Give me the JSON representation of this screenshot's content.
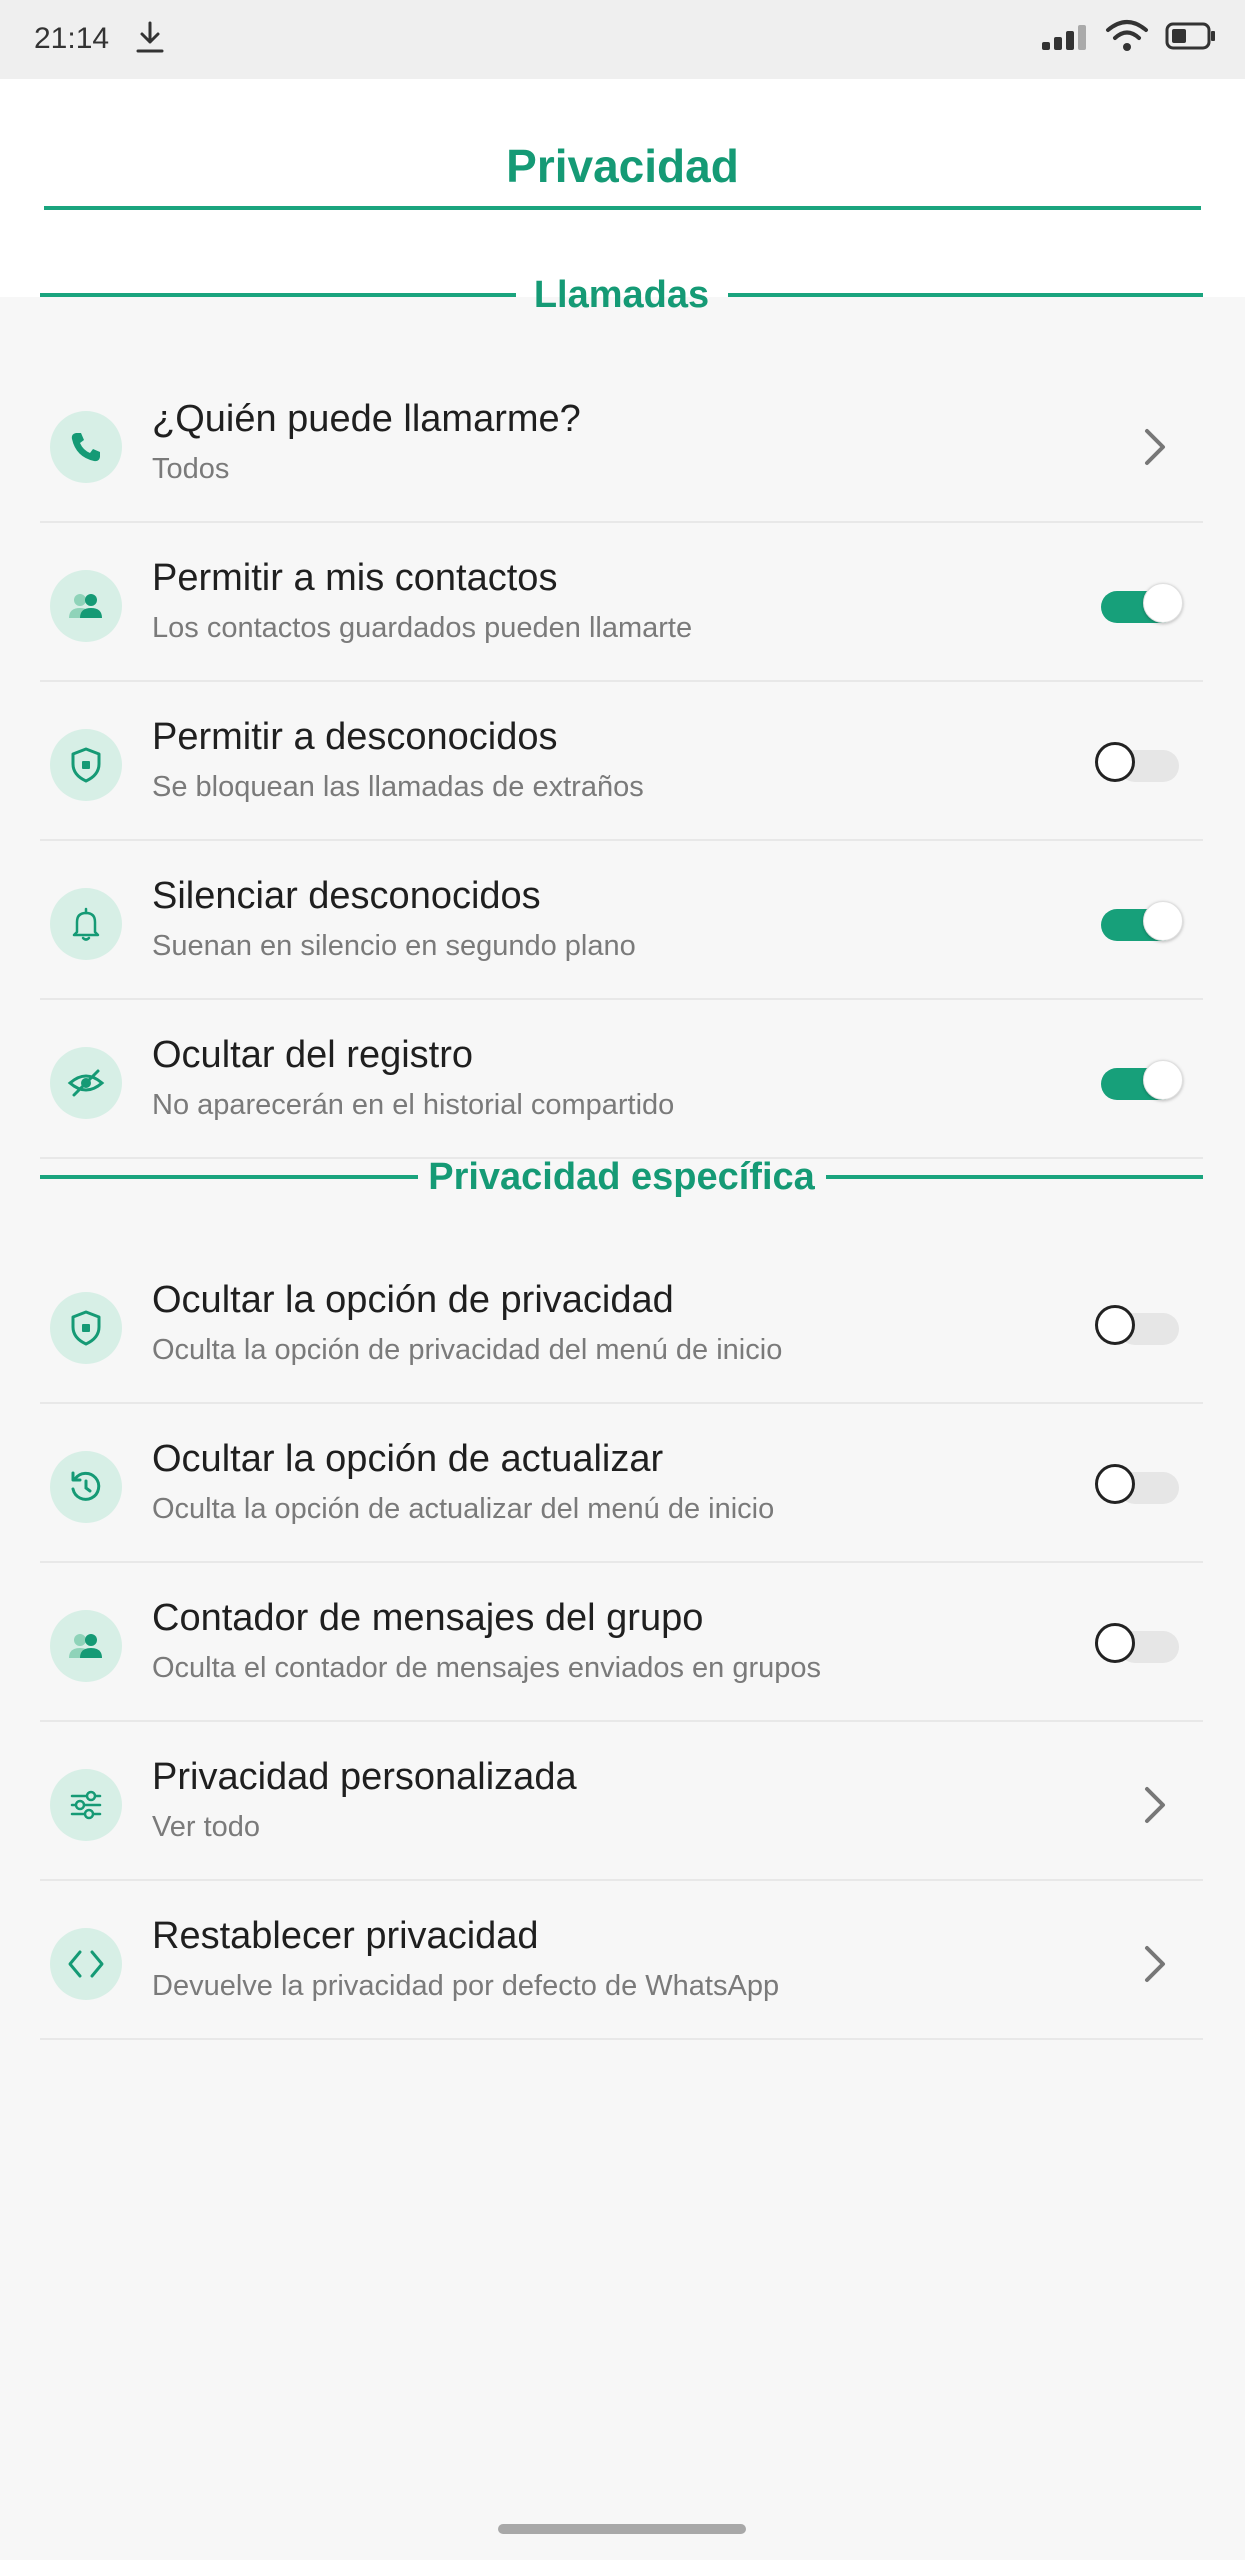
{
  "status_bar": {
    "time": "21:14"
  },
  "header": {
    "title": "Privacidad"
  },
  "sections": {
    "calls": {
      "label": "Llamadas",
      "items": [
        {
          "title": "¿Quién puede llamarme?",
          "subtitle": "Todos",
          "control": "chevron",
          "icon": "phone-icon"
        },
        {
          "title": "Permitir a mis contactos",
          "subtitle": "Los contactos guardados pueden llamarte",
          "control": "toggle",
          "on": true,
          "icon": "contacts-icon"
        },
        {
          "title": "Permitir a desconocidos",
          "subtitle": "Se bloquean las llamadas de extraños",
          "control": "toggle",
          "on": false,
          "icon": "shield-icon"
        },
        {
          "title": "Silenciar desconocidos",
          "subtitle": "Suenan en silencio en segundo plano",
          "control": "toggle",
          "on": true,
          "icon": "bell-icon"
        },
        {
          "title": "Ocultar del registro",
          "subtitle": "No aparecerán en el historial compartido",
          "control": "toggle",
          "on": true,
          "icon": "eye-off-icon"
        }
      ]
    },
    "specific": {
      "label": "Privacidad específica",
      "items": [
        {
          "title": "Ocultar la opción de privacidad",
          "subtitle": "Oculta la opción de privacidad del menú de inicio",
          "control": "toggle",
          "on": false,
          "icon": "shield-icon"
        },
        {
          "title": "Ocultar la opción de actualizar",
          "subtitle": "Oculta la opción de actualizar del menú de inicio",
          "control": "toggle",
          "on": false,
          "icon": "refresh-icon"
        },
        {
          "title": "Contador de mensajes del grupo",
          "subtitle": "Oculta el contador de mensajes enviados en grupos",
          "control": "toggle",
          "on": false,
          "icon": "contacts-icon"
        },
        {
          "title": "Privacidad personalizada",
          "subtitle": "Ver todo",
          "control": "chevron",
          "icon": "sliders-icon"
        },
        {
          "title": "Restablecer privacidad",
          "subtitle": "Devuelve la privacidad por defecto de WhatsApp",
          "control": "chevron",
          "icon": "code-icon"
        }
      ]
    }
  },
  "colors": {
    "accent": "#159a75",
    "toggle_on": "#17a07a",
    "icon_bg": "#d7efe6"
  }
}
